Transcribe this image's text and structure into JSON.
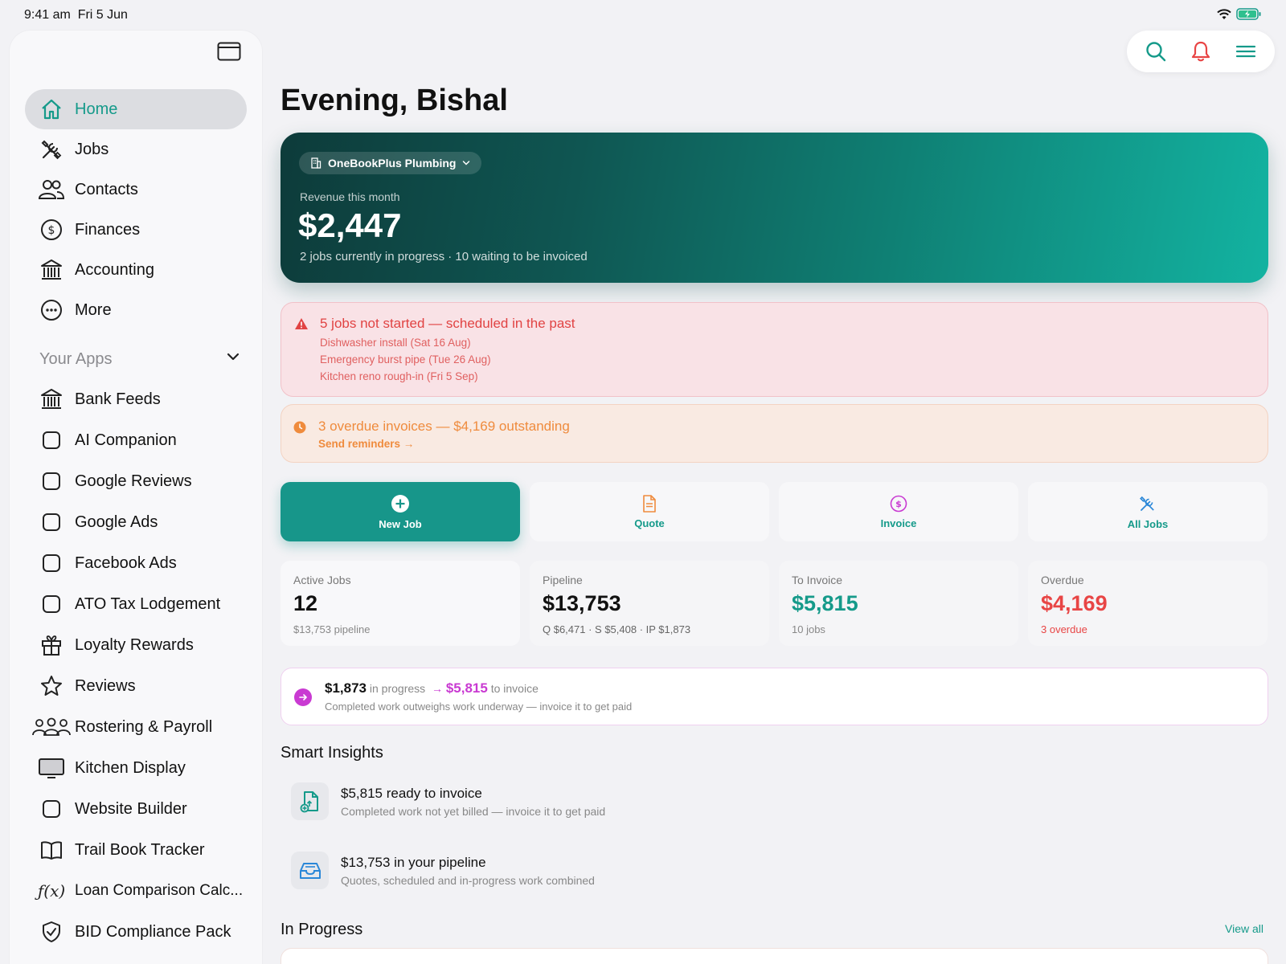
{
  "status": {
    "time": "9:41 am",
    "date": "Fri 5 Jun"
  },
  "sidebar": {
    "nav": [
      {
        "label": "Home",
        "icon": "home-icon",
        "active": true
      },
      {
        "label": "Jobs",
        "icon": "tools-icon"
      },
      {
        "label": "Contacts",
        "icon": "people-icon"
      },
      {
        "label": "Finances",
        "icon": "dollar-circle-icon"
      },
      {
        "label": "Accounting",
        "icon": "bank-icon"
      },
      {
        "label": "More",
        "icon": "more-circle-icon"
      }
    ],
    "apps_title": "Your Apps",
    "apps": [
      {
        "label": "Bank Feeds",
        "icon": "bank-icon"
      },
      {
        "label": "AI Companion",
        "icon": "square-icon"
      },
      {
        "label": "Google Reviews",
        "icon": "square-icon"
      },
      {
        "label": "Google Ads",
        "icon": "square-icon"
      },
      {
        "label": "Facebook Ads",
        "icon": "square-icon"
      },
      {
        "label": "ATO Tax Lodgement",
        "icon": "square-icon"
      },
      {
        "label": "Loyalty Rewards",
        "icon": "gift-icon"
      },
      {
        "label": "Reviews",
        "icon": "star-icon"
      },
      {
        "label": "Rostering & Payroll",
        "icon": "group-icon"
      },
      {
        "label": "Kitchen Display",
        "icon": "monitor-icon"
      },
      {
        "label": "Website Builder",
        "icon": "square-icon"
      },
      {
        "label": "Trail Book Tracker",
        "icon": "book-icon"
      },
      {
        "label": "Loan Comparison Calc...",
        "icon": "function-icon"
      },
      {
        "label": "BID Compliance Pack",
        "icon": "shield-check-icon"
      }
    ]
  },
  "greeting": "Evening, Bishal",
  "hero": {
    "business": "OneBookPlus Plumbing",
    "label": "Revenue this month",
    "amount": "$2,447",
    "sub": "2 jobs currently in progress · 10 waiting to be invoiced"
  },
  "alerts": {
    "red": {
      "title": "5 jobs not started — scheduled in the past",
      "lines": [
        "Dishwasher install (Sat 16 Aug)",
        "Emergency burst pipe (Tue 26 Aug)",
        "Kitchen reno rough-in (Fri 5 Sep)"
      ]
    },
    "orange": {
      "title": "3 overdue invoices — $4,169 outstanding",
      "link": "Send reminders →"
    }
  },
  "actions": [
    {
      "label": "New Job",
      "icon": "plus-circle-icon",
      "primary": true
    },
    {
      "label": "Quote",
      "icon": "document-icon",
      "color": "#ef8b3d"
    },
    {
      "label": "Invoice",
      "icon": "dollar-circle-icon",
      "color": "#c93ad2"
    },
    {
      "label": "All Jobs",
      "icon": "tools-icon",
      "color": "#2a87d8"
    }
  ],
  "stats": [
    {
      "label": "Active Jobs",
      "value": "12",
      "sub": "$13,753 pipeline",
      "value_color": "#111111",
      "sub_color": "#888888"
    },
    {
      "label": "Pipeline",
      "value": "$13,753",
      "sub": "Q $6,471 · S $5,408 · IP $1,873",
      "value_color": "#111111",
      "sub_color": "#666666"
    },
    {
      "label": "To Invoice",
      "value": "$5,815",
      "sub": "10 jobs",
      "value_color": "#159a8a",
      "sub_color": "#888888"
    },
    {
      "label": "Overdue",
      "value": "$4,169",
      "sub": "3 overdue",
      "value_color": "#e84545",
      "sub_color": "#e84545"
    }
  ],
  "flow": {
    "amount_progress": "$1,873",
    "progress_text": "in progress",
    "arrow": "→",
    "amount_invoice": "$5,815",
    "invoice_text": "to invoice",
    "note": "Completed work outweighs work underway — invoice it to get paid"
  },
  "insights": {
    "title": "Smart Insights",
    "items": [
      {
        "title": "$5,815 ready to invoice",
        "sub": "Completed work not yet billed — invoice it to get paid",
        "icon": "invoice-doc-icon"
      },
      {
        "title": "$13,753 in your pipeline",
        "sub": "Quotes, scheduled and in-progress work combined",
        "icon": "inbox-tray-icon"
      }
    ]
  },
  "in_progress": {
    "title": "In Progress",
    "view_all": "View all"
  },
  "colors": {
    "teal": "#159a8a",
    "red": "#e14343",
    "orange": "#ef8b3d",
    "magenta": "#c93ad2",
    "blue": "#2a87d8"
  }
}
